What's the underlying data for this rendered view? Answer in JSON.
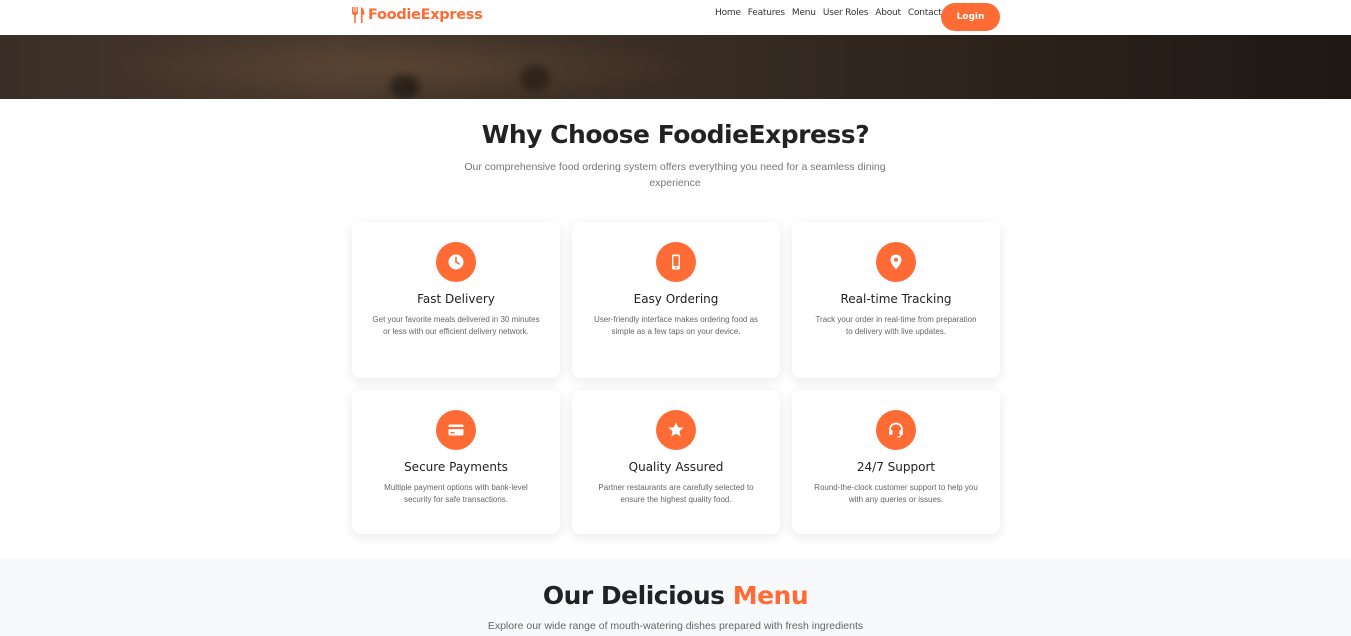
{
  "brand": {
    "name": "FoodieExpress",
    "color": "#ff6b35",
    "icon": "utensils-icon"
  },
  "nav": {
    "items": [
      "Home",
      "Features",
      "Menu",
      "User Roles",
      "About",
      "Contact"
    ],
    "login_label": "Login"
  },
  "features": {
    "title": "Why Choose FoodieExpress?",
    "subtitle": "Our comprehensive food ordering system offers everything you need for a seamless dining experience",
    "cards": [
      {
        "icon": "clock-icon",
        "title": "Fast Delivery",
        "desc": "Get your favorite meals delivered in 30 minutes or less with our efficient delivery network."
      },
      {
        "icon": "mobile-icon",
        "title": "Easy Ordering",
        "desc": "User-friendly interface makes ordering food as simple as a few taps on your device."
      },
      {
        "icon": "map-pin-icon",
        "title": "Real-time Tracking",
        "desc": "Track your order in real-time from preparation to delivery with live updates."
      },
      {
        "icon": "credit-card-icon",
        "title": "Secure Payments",
        "desc": "Multiple payment options with bank-level security for safe transactions."
      },
      {
        "icon": "star-icon",
        "title": "Quality Assured",
        "desc": "Partner restaurants are carefully selected to ensure the highest quality food."
      },
      {
        "icon": "headset-icon",
        "title": "24/7 Support",
        "desc": "Round-the-clock customer support to help you with any queries or issues."
      }
    ]
  },
  "menu": {
    "title_main": "Our Delicious ",
    "title_accent": "Menu",
    "subtitle": "Explore our wide range of mouth-watering dishes prepared with fresh ingredients"
  }
}
